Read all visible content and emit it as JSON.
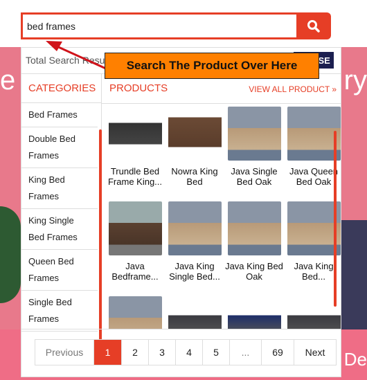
{
  "search": {
    "value": "bed frames",
    "icon": "search-icon"
  },
  "banner": {
    "left_text": "e",
    "right_text": "ry",
    "bottom_right_text": "De"
  },
  "results": {
    "total_label": "Total Search Result",
    "close_label": "CLOSE"
  },
  "categories": {
    "title": "CATEGORIES",
    "items": [
      "Bed Frames",
      "Double Bed Frames",
      "King Bed Frames",
      "King Single Bed Frames",
      "Queen Bed Frames",
      "Single Bed Frames"
    ]
  },
  "products": {
    "title": "PRODUCTS",
    "view_all": "VIEW ALL PRODUCT »",
    "items": [
      {
        "name": "Trundle Bed Frame King..."
      },
      {
        "name": "Nowra King Bed"
      },
      {
        "name": "Java Single Bed Oak"
      },
      {
        "name": "Java Queen Bed Oak"
      },
      {
        "name": "Java Bedframe..."
      },
      {
        "name": "Java King Single Bed..."
      },
      {
        "name": "Java King Bed Oak"
      },
      {
        "name": "Java King Bed..."
      },
      {
        "name": ""
      },
      {
        "name": ""
      },
      {
        "name": ""
      },
      {
        "name": ""
      }
    ]
  },
  "pagination": {
    "items": [
      "Previous",
      "1",
      "2",
      "3",
      "4",
      "5",
      "...",
      "69",
      "Next"
    ],
    "active": "1"
  },
  "annotation": {
    "text": "Search The Product Over Here"
  },
  "colors": {
    "accent": "#e63e26",
    "close_bg": "#1c1f50",
    "annotation_bg": "#ff8000"
  }
}
